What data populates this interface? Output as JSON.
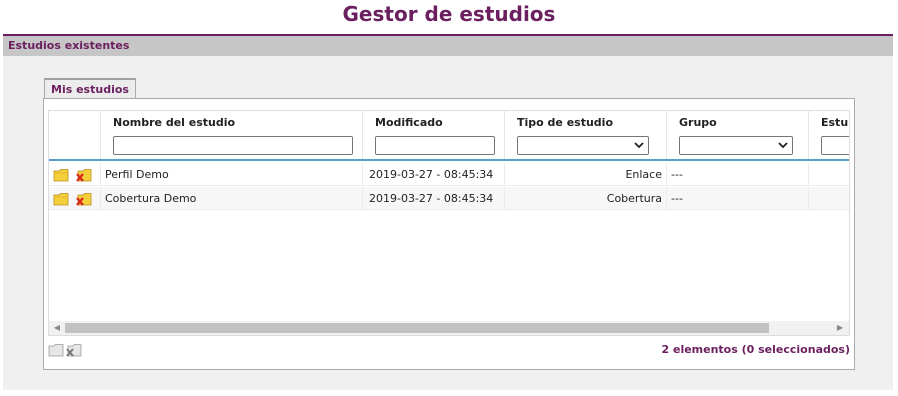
{
  "page": {
    "title": "Gestor de estudios"
  },
  "section": {
    "label": "Estudios existentes"
  },
  "tabs": [
    {
      "label": "Mis estudios"
    }
  ],
  "grid": {
    "columns": [
      {
        "label": ""
      },
      {
        "label": "Nombre del estudio",
        "filter": "text",
        "value": ""
      },
      {
        "label": "Modificado",
        "filter": "text",
        "value": ""
      },
      {
        "label": "Tipo de estudio",
        "filter": "select",
        "value": ""
      },
      {
        "label": "Grupo",
        "filter": "select",
        "value": ""
      },
      {
        "label": "Estu"
      }
    ],
    "rows": [
      {
        "name": "Perfil Demo",
        "modified": "2019-03-27 - 08:45:34",
        "type": "Enlace",
        "group": "---"
      },
      {
        "name": "Cobertura Demo",
        "modified": "2019-03-27 - 08:45:34",
        "type": "Cobertura",
        "group": "---"
      }
    ]
  },
  "footer": {
    "count_text": "2 elementos   (0 seleccionados)"
  },
  "icons": {
    "open": "folder-icon",
    "delete": "delete-folder-icon"
  },
  "colors": {
    "accent": "#6b1f5e",
    "header_line": "#5a9fc8",
    "folder": "#f5cf3b",
    "delete": "#d8251b"
  }
}
